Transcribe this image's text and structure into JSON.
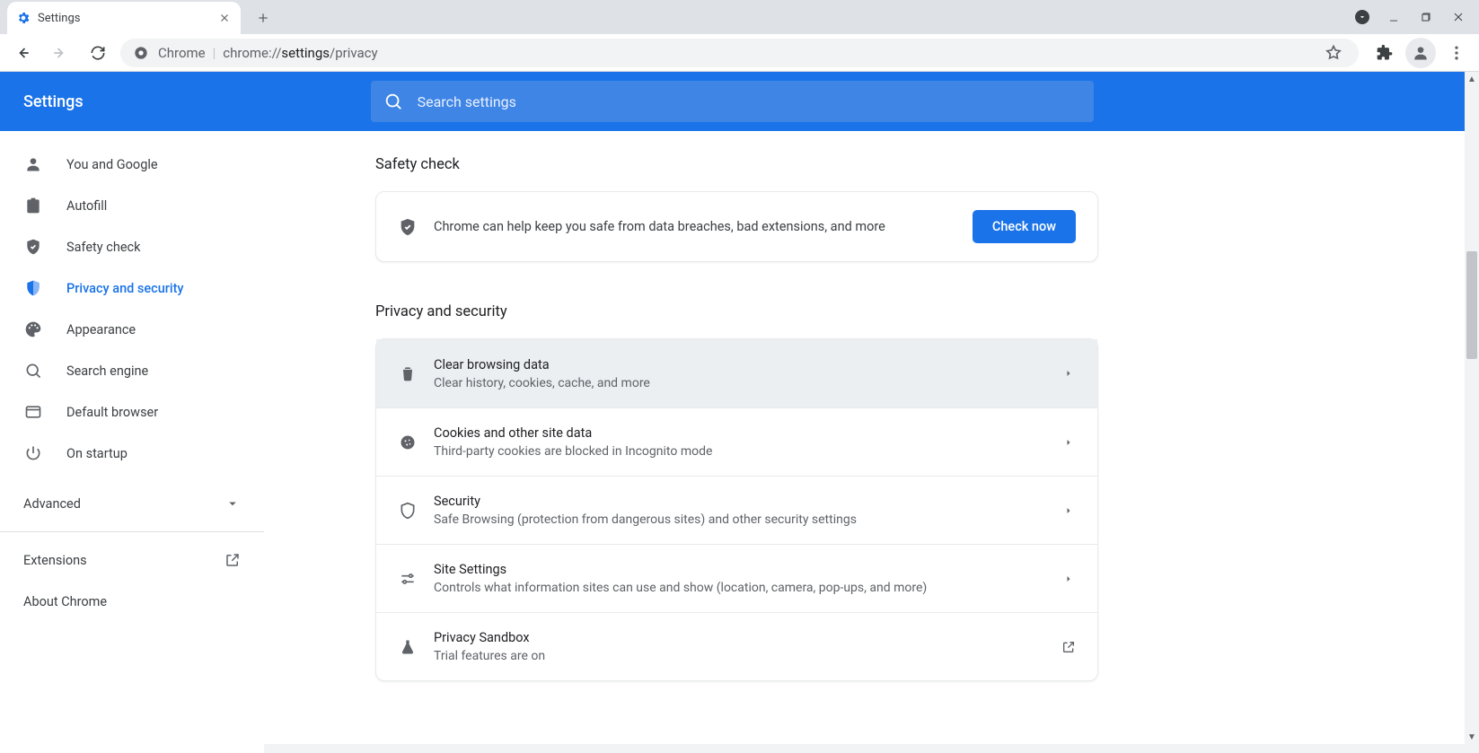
{
  "browser": {
    "tab_title": "Settings",
    "omnibox_site": "Chrome",
    "omnibox_url_prefix": "chrome://",
    "omnibox_url_dark": "settings",
    "omnibox_url_suffix": "/privacy"
  },
  "header": {
    "title": "Settings",
    "search_placeholder": "Search settings"
  },
  "sidebar": {
    "items": [
      {
        "label": "You and Google"
      },
      {
        "label": "Autofill"
      },
      {
        "label": "Safety check"
      },
      {
        "label": "Privacy and security"
      },
      {
        "label": "Appearance"
      },
      {
        "label": "Search engine"
      },
      {
        "label": "Default browser"
      },
      {
        "label": "On startup"
      }
    ],
    "advanced": "Advanced",
    "extensions": "Extensions",
    "about": "About Chrome"
  },
  "main": {
    "safety_title": "Safety check",
    "safety_desc": "Chrome can help keep you safe from data breaches, bad extensions, and more",
    "check_now": "Check now",
    "privacy_title": "Privacy and security",
    "rows": [
      {
        "title": "Clear browsing data",
        "sub": "Clear history, cookies, cache, and more"
      },
      {
        "title": "Cookies and other site data",
        "sub": "Third-party cookies are blocked in Incognito mode"
      },
      {
        "title": "Security",
        "sub": "Safe Browsing (protection from dangerous sites) and other security settings"
      },
      {
        "title": "Site Settings",
        "sub": "Controls what information sites can use and show (location, camera, pop-ups, and more)"
      },
      {
        "title": "Privacy Sandbox",
        "sub": "Trial features are on"
      }
    ]
  }
}
